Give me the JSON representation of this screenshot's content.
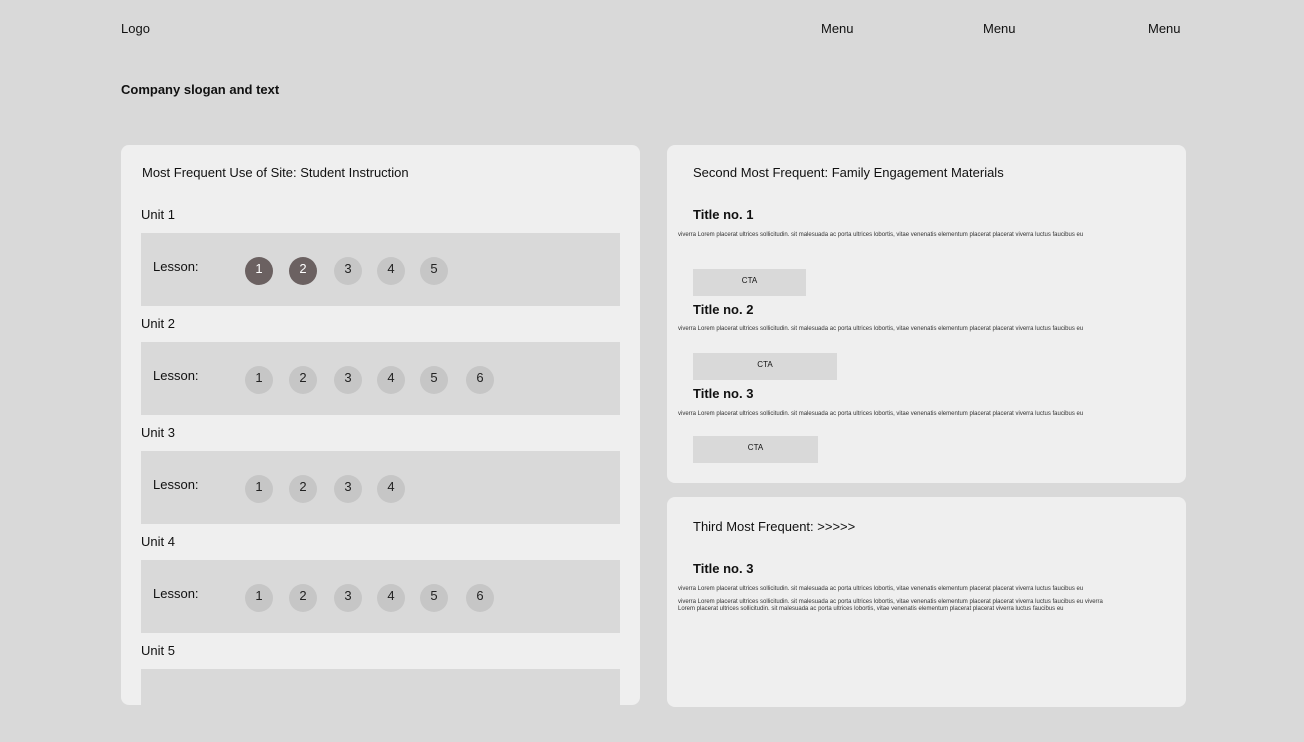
{
  "header": {
    "logo": "Logo",
    "menu": [
      "Menu",
      "Menu",
      "Menu"
    ],
    "slogan": "Company slogan and text"
  },
  "panel1": {
    "title": "Most Frequent Use of Site:  Student Instruction",
    "lesson_label": "Lesson:",
    "units": [
      {
        "label": "Unit 1",
        "lessons": [
          "1",
          "2",
          "3",
          "4",
          "5"
        ],
        "active": [
          "1",
          "2"
        ]
      },
      {
        "label": "Unit 2",
        "lessons": [
          "1",
          "2",
          "3",
          "4",
          "5",
          "6"
        ],
        "active": []
      },
      {
        "label": "Unit 3",
        "lessons": [
          "1",
          "2",
          "3",
          "4"
        ],
        "active": []
      },
      {
        "label": "Unit 4",
        "lessons": [
          "1",
          "2",
          "3",
          "4",
          "5",
          "6"
        ],
        "active": []
      },
      {
        "label": "Unit 5",
        "lessons": [],
        "active": []
      }
    ]
  },
  "panel2": {
    "title": "Second Most Frequent:  Family Engagement Materials",
    "items": [
      {
        "title": "Title no. 1",
        "text": "viverra Lorem placerat ultrices sollicitudin. sit malesuada ac porta ultrices lobortis, vitae venenatis elementum placerat placerat viverra luctus faucibus eu",
        "cta": "CTA"
      },
      {
        "title": "Title no. 2",
        "text": "viverra Lorem placerat ultrices sollicitudin. sit malesuada ac porta ultrices lobortis, vitae venenatis elementum placerat placerat viverra luctus faucibus eu",
        "cta": "CTA"
      },
      {
        "title": "Title no. 3",
        "text": "viverra Lorem placerat ultrices sollicitudin. sit malesuada ac porta ultrices lobortis, vitae venenatis elementum placerat placerat viverra luctus faucibus eu",
        "cta": "CTA"
      }
    ]
  },
  "panel3": {
    "title": "Third Most Frequent:  >>>>>",
    "item_title": "Title no. 3",
    "text1": "viverra Lorem placerat ultrices sollicitudin. sit malesuada ac porta ultrices lobortis, vitae venenatis elementum placerat placerat viverra luctus faucibus eu",
    "text2": "viverra Lorem placerat ultrices sollicitudin. sit malesuada ac porta ultrices lobortis, vitae venenatis elementum placerat placerat viverra luctus faucibus eu viverra",
    "text3": "Lorem placerat ultrices sollicitudin. sit malesuada ac porta ultrices lobortis, vitae venenatis elementum placerat placerat viverra luctus faucibus eu"
  }
}
